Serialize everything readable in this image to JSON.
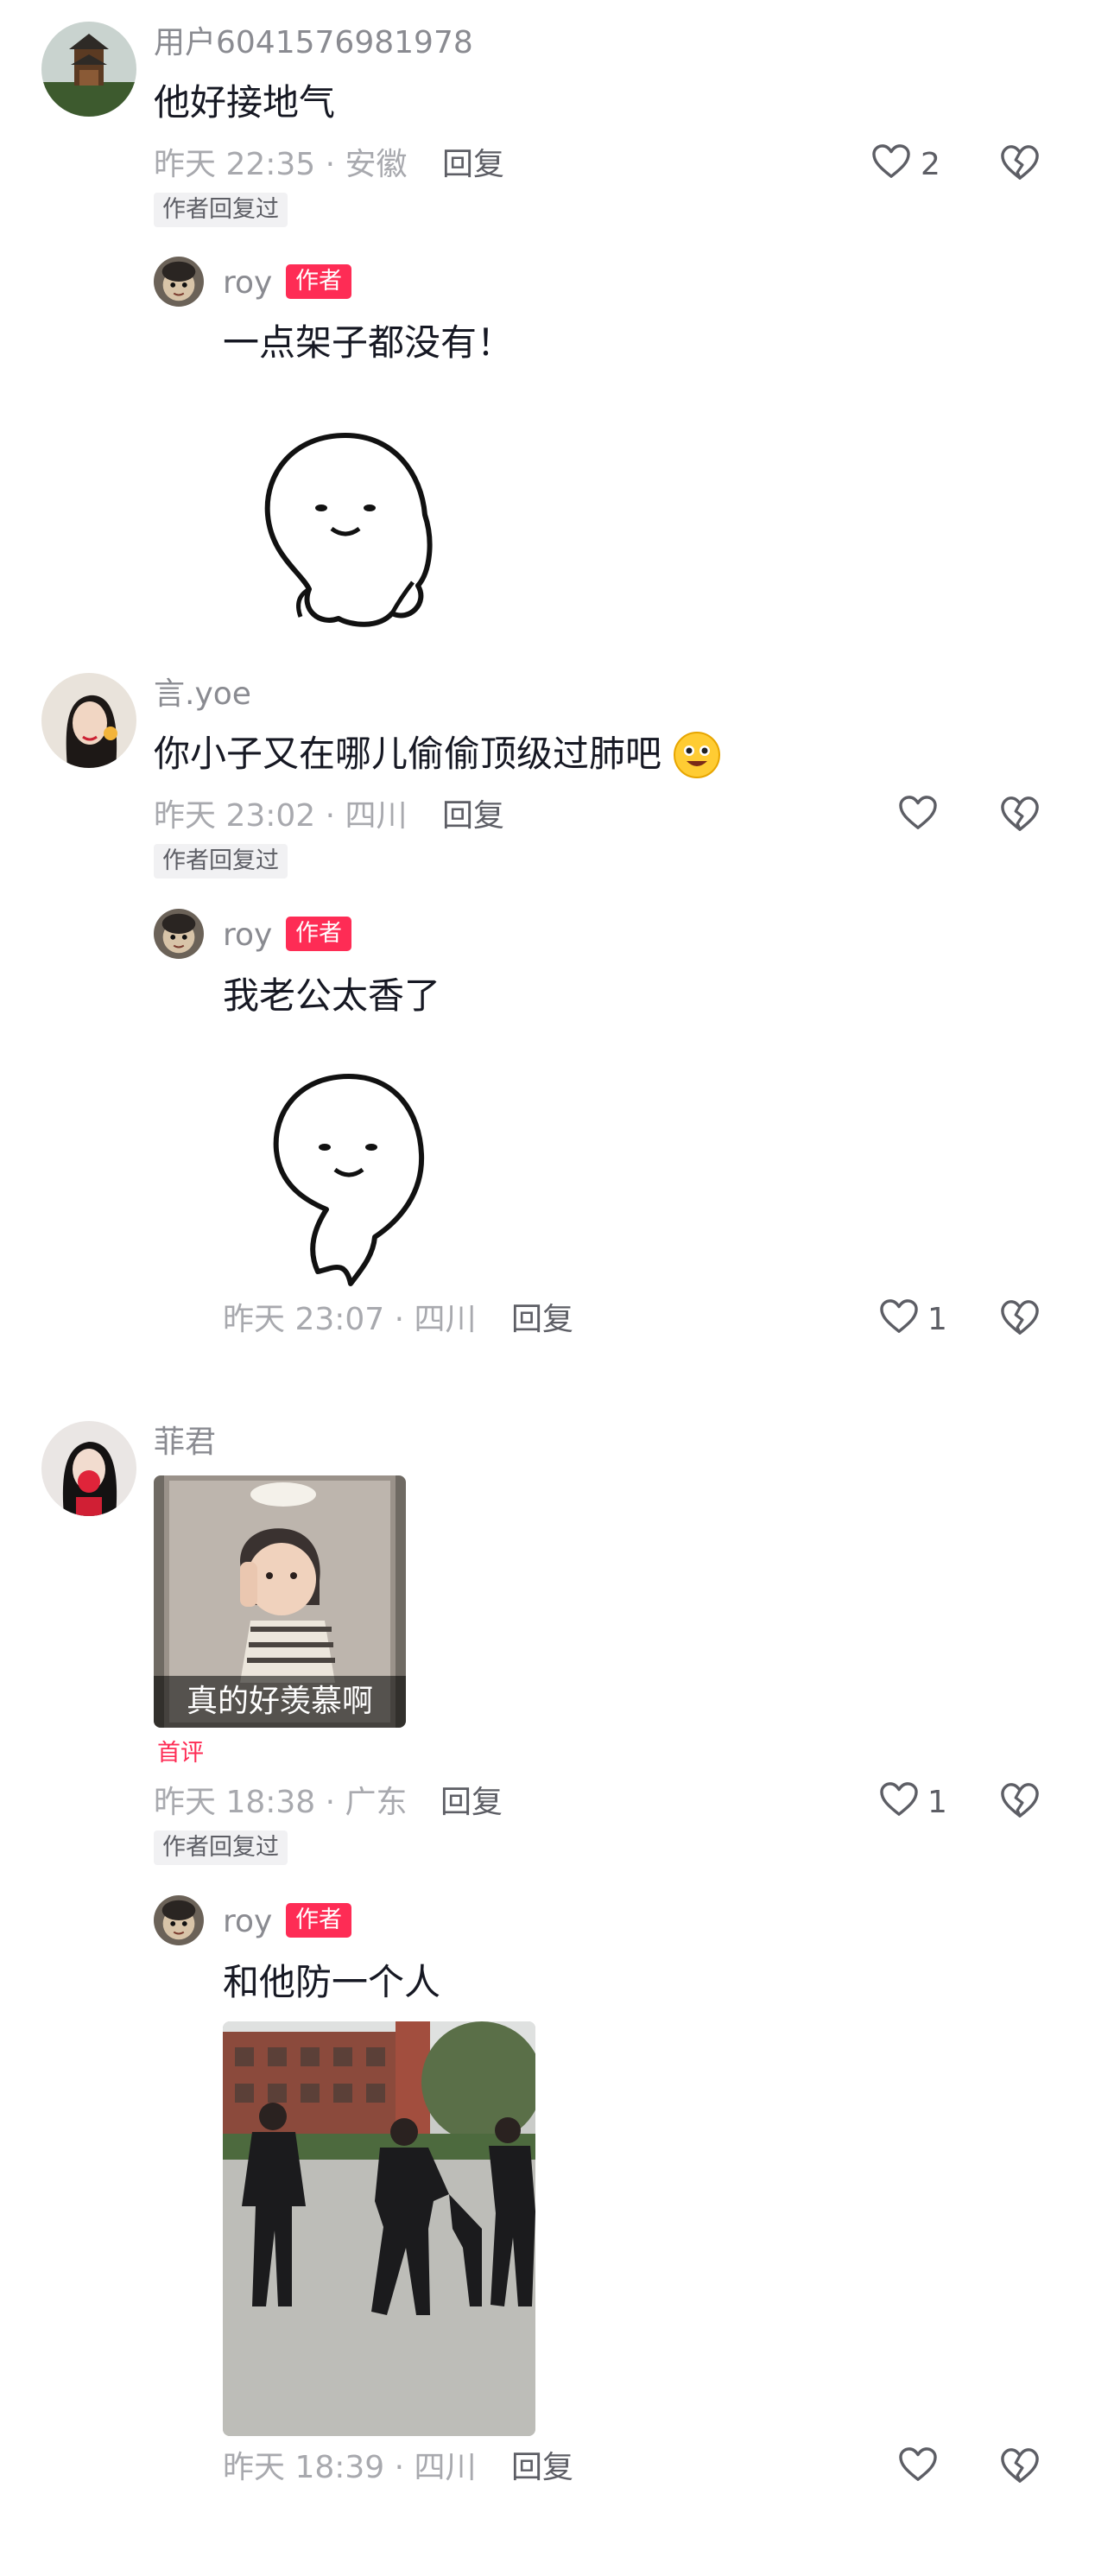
{
  "comments": [
    {
      "username": "用户6041576981978",
      "text": "他好接地气",
      "time_location": "昨天 22:35 · 安徽",
      "reply_label": "回复",
      "like_count": "2",
      "author_replied_tag": "作者回复过",
      "reply": {
        "username": "roy",
        "author_tag": "作者",
        "text": "一点架子都没有！",
        "sticker": "smiling-ghost-sticker"
      }
    },
    {
      "username": "言.yoe",
      "text": "你小子又在哪儿偷偷顶级过肺吧",
      "emoji": "smiley-emoji",
      "time_location": "昨天 23:02 · 四川",
      "reply_label": "回复",
      "author_replied_tag": "作者回复过",
      "reply": {
        "username": "roy",
        "author_tag": "作者",
        "text": "我老公太香了",
        "sticker": "dancing-ghost-sticker",
        "time_location": "昨天 23:07 · 四川",
        "reply_label": "回复",
        "like_count": "1"
      }
    },
    {
      "username": "菲君",
      "image_caption": "真的好羡慕啊",
      "first_comment_tag": "首评",
      "time_location": "昨天 18:38 · 广东",
      "reply_label": "回复",
      "like_count": "1",
      "author_replied_tag": "作者回复过",
      "reply": {
        "username": "roy",
        "author_tag": "作者",
        "text": "和他防一个人",
        "image": "group-dance-photo",
        "time_location": "昨天 18:39 · 四川",
        "reply_label": "回复"
      }
    }
  ],
  "colors": {
    "accent": "#fe2c55",
    "text": "#161823",
    "meta": "#a8a9ae"
  },
  "icons": {
    "like": "heart-outline-icon",
    "dislike": "broken-heart-icon"
  }
}
